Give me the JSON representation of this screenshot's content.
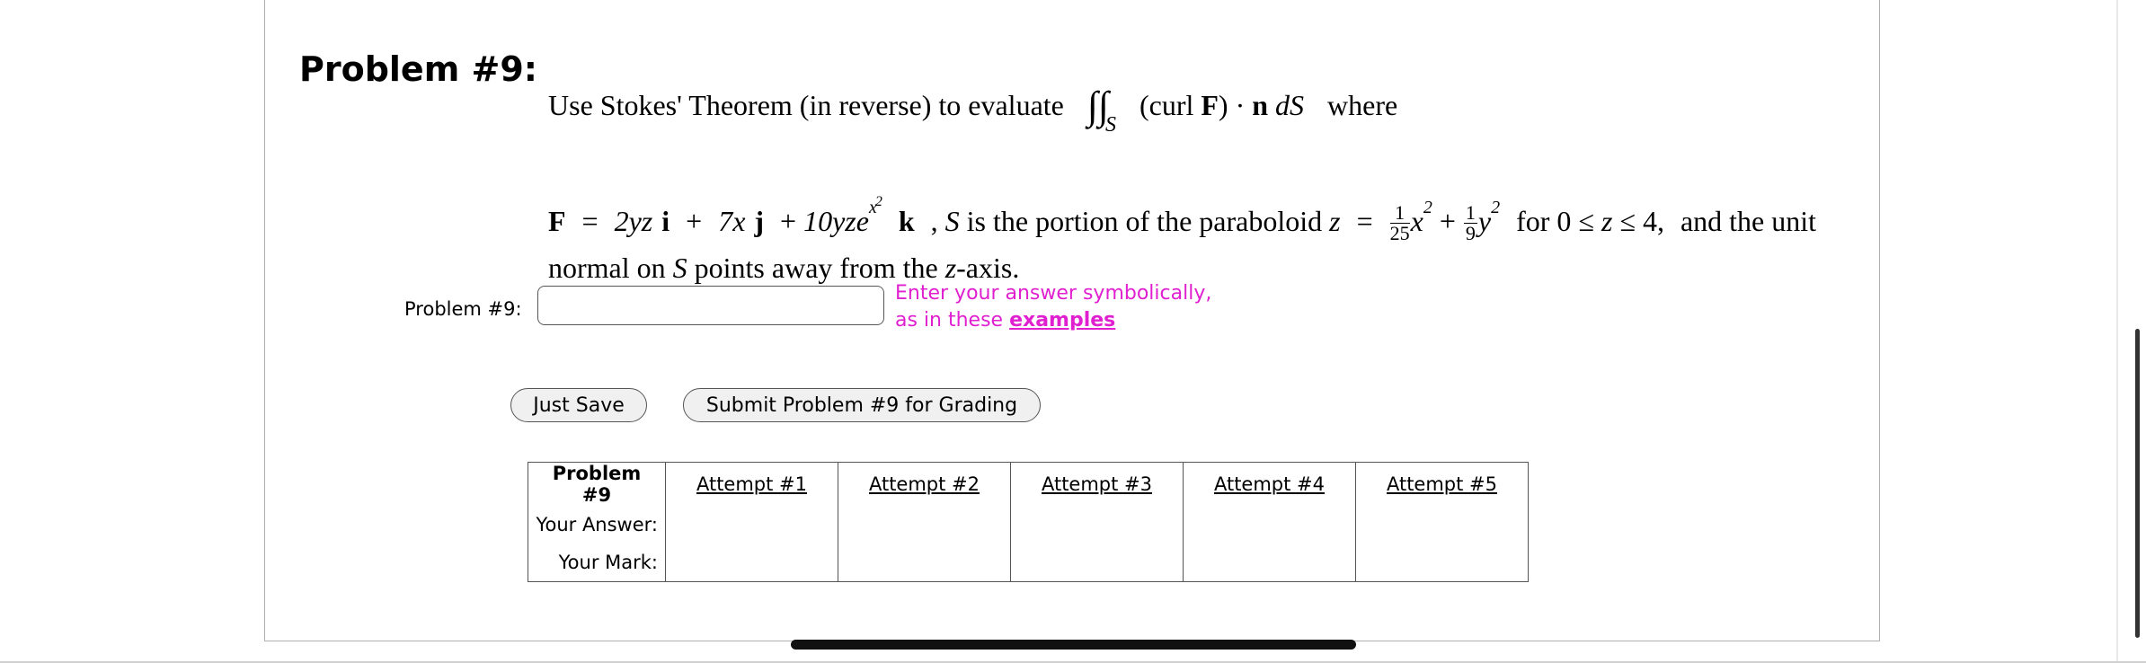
{
  "problem": {
    "heading": "Problem #9:",
    "line1_prefix": "Use Stokes' Theorem (in reverse) to evaluate",
    "line1_integral": "∫∫",
    "line1_sub": "S",
    "line1_integrand_open": "(curl ",
    "line1_F": "F",
    "line1_integrand_close": ") · ",
    "line1_n": "n",
    "line1_dS": "dS",
    "line1_suffix": "where",
    "line2": {
      "F": "F",
      "eq": "=",
      "term1": "2yz",
      "i": "i",
      "plus1": "+",
      "term2": "7x",
      "j": "j",
      "plus2": "+",
      "term3": "10yze",
      "exp_base": "x",
      "exp_power": "2",
      "k": "k",
      "comma_text": ", ",
      "S": "S",
      "is_text": " is the portion of the paraboloid ",
      "z": "z",
      "eq2": "=",
      "frac1_num": "1",
      "frac1_den": "25",
      "x": "x",
      "sq1": "2",
      "plus3": "+",
      "frac2_num": "1",
      "frac2_den": "9",
      "y": "y",
      "sq2": "2",
      "range_text_for": "for 0 ≤ ",
      "range_z": "z",
      "range_text_end": " ≤ 4,",
      "and_text": "and the unit"
    },
    "line3": {
      "normal_text": "normal on ",
      "S": "S",
      "points_text": " points away from the ",
      "z": "z",
      "axis_text": "-axis."
    }
  },
  "answer": {
    "label": "Problem #9:",
    "value": "",
    "placeholder": ""
  },
  "hint": {
    "line1": "Enter your answer symbolically,",
    "line2_prefix": "as in these ",
    "link": "examples"
  },
  "buttons": {
    "save": "Just Save",
    "submit": "Submit Problem #9 for Grading"
  },
  "attempts_table": {
    "corner": "Problem #9",
    "attempts": [
      "Attempt #1",
      "Attempt #2",
      "Attempt #3",
      "Attempt #4",
      "Attempt #5"
    ],
    "row_your_answer": "Your Answer:",
    "row_your_mark": "Your Mark:"
  },
  "colors": {
    "hint": "#e020d0",
    "border": "#555555"
  }
}
